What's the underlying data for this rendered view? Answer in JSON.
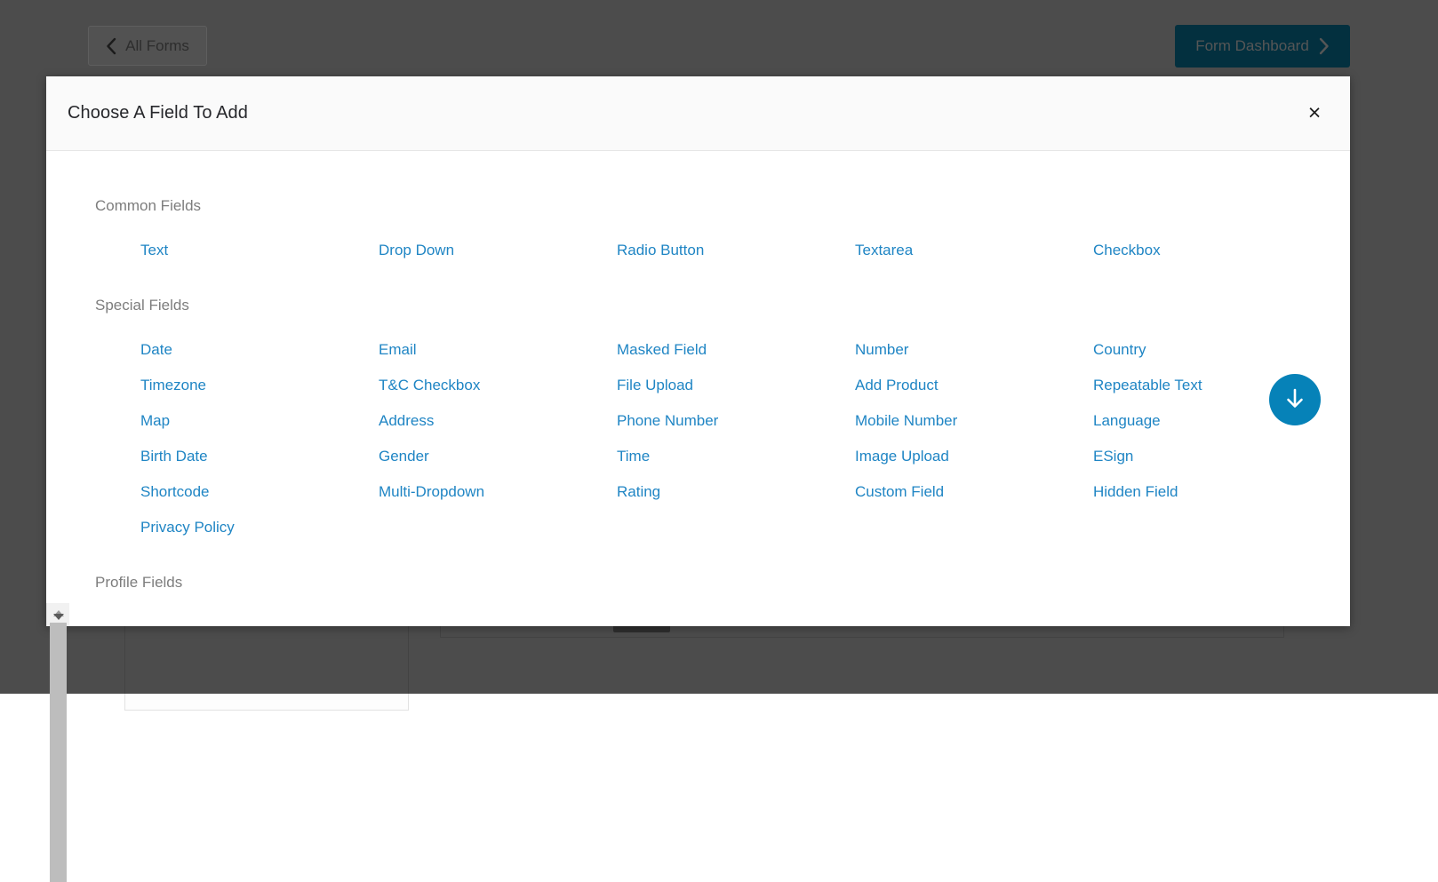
{
  "topbar": {
    "back_button": {
      "label": "All Forms",
      "icon": "chevron-left-icon"
    },
    "dashboard_button": {
      "label": "Form Dashboard",
      "icon": "chevron-right-icon",
      "color": "#03303f"
    }
  },
  "modal": {
    "title": "Choose A Field To Add",
    "close_label": "×",
    "accent_color": "#1f85c4",
    "groups": [
      {
        "title": "Common Fields",
        "fields": [
          "Text",
          "Drop Down",
          "Radio Button",
          "Textarea",
          "Checkbox"
        ]
      },
      {
        "title": "Special Fields",
        "fields": [
          "Date",
          "Email",
          "Masked Field",
          "Number",
          "Country",
          "Timezone",
          "T&C Checkbox",
          "File Upload",
          "Add Product",
          "Repeatable Text",
          "Map",
          "Address",
          "Phone Number",
          "Mobile Number",
          "Language",
          "Birth Date",
          "Gender",
          "Time",
          "Image Upload",
          "ESign",
          "Shortcode",
          "Multi-Dropdown",
          "Rating",
          "Custom Field",
          "Hidden Field",
          "Privacy Policy"
        ]
      },
      {
        "title": "Profile Fields",
        "fields": []
      }
    ],
    "scrollbar": {
      "up_icon": "scroll-up-arrow-icon",
      "down_icon": "scroll-down-arrow-icon"
    }
  },
  "fab": {
    "icon": "arrow-down-icon",
    "color": "#0682b8"
  }
}
